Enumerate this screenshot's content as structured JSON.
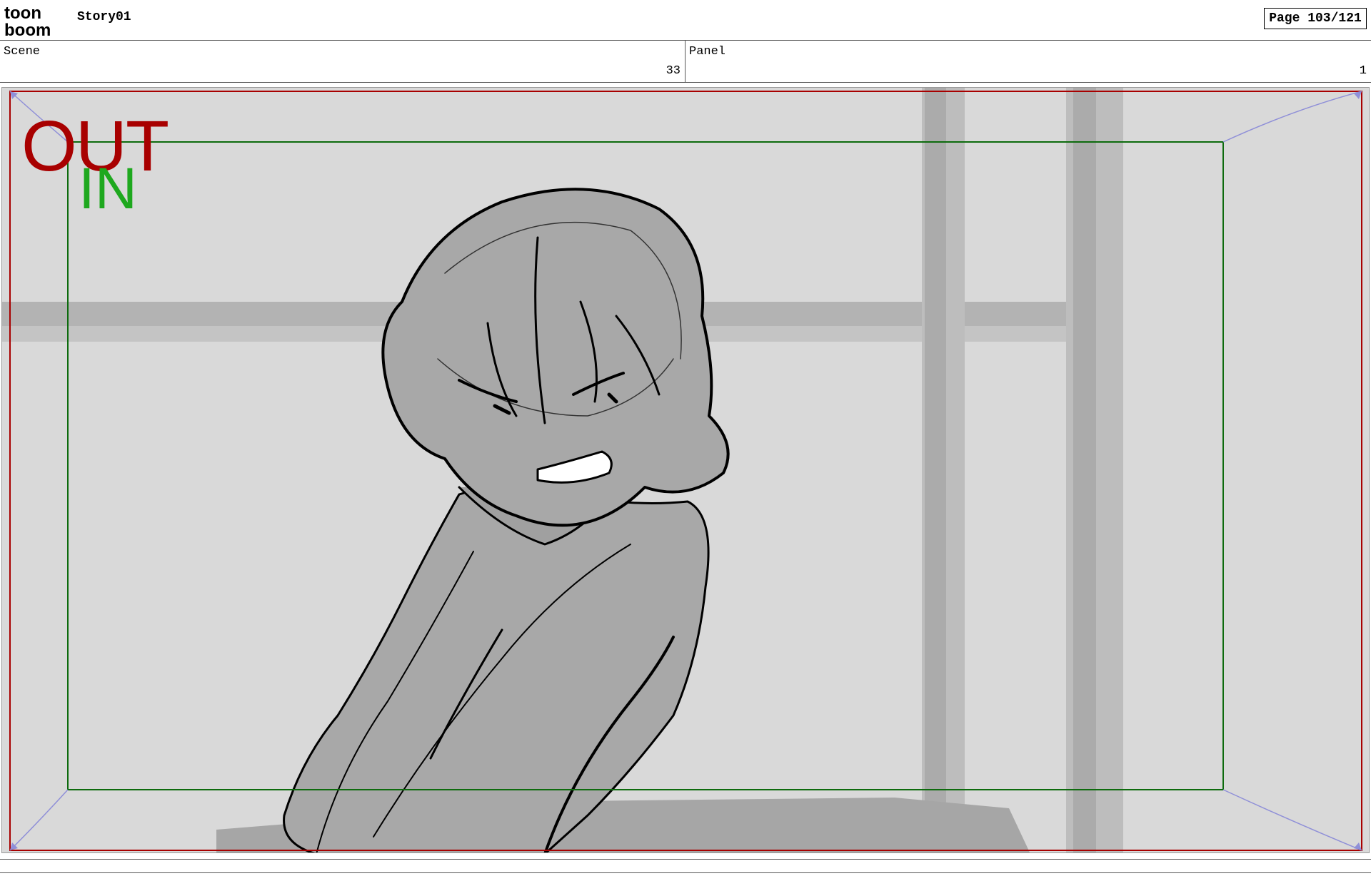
{
  "header": {
    "logo_text_top": "toon",
    "logo_text_bottom": "boom",
    "project_title": "Story01",
    "page_indicator": "Page 103/121"
  },
  "fields": {
    "scene": {
      "label": "Scene",
      "value": "33"
    },
    "panel": {
      "label": "Panel",
      "value": "1"
    }
  },
  "frame": {
    "out_label": "OUT",
    "in_label": "IN",
    "colors": {
      "out_frame": "#a80000",
      "in_frame": "#0d6b0d",
      "camera_path": "#8f8fd8"
    }
  },
  "icons": [
    "toon-boom-logo",
    "camera-path-arrow-icon"
  ]
}
